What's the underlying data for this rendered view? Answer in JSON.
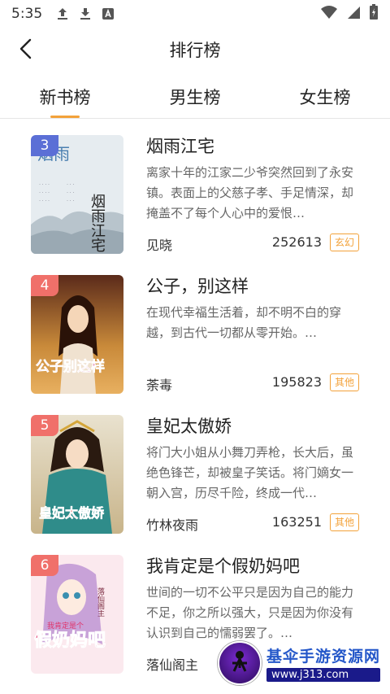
{
  "status_bar": {
    "time": "5:35",
    "left_icons": [
      "upload-icon",
      "download-icon",
      "a-box-icon"
    ],
    "right_icons": [
      "wifi-icon",
      "signal-icon",
      "battery-icon"
    ]
  },
  "header": {
    "title": "排行榜",
    "back_icon": "chevron-left-icon"
  },
  "tabs": [
    {
      "label": "新书榜",
      "active": true
    },
    {
      "label": "男生榜",
      "active": false
    },
    {
      "label": "女生榜",
      "active": false
    }
  ],
  "colors": {
    "accent": "#f3a23a",
    "rank_3": "#5b6fd6",
    "rank_4": "#f0706a",
    "rank_5": "#f0706a",
    "rank_6": "#f0706a"
  },
  "books": [
    {
      "rank": "3",
      "title": "烟雨江宅",
      "description": "离家十年的江家二少爷突然回到了永安镇。表面上的父慈子孝、手足情深，却掩盖不了每个人心中的爱恨…",
      "author": "见晓",
      "count": "252613",
      "tag": "玄幻"
    },
    {
      "rank": "4",
      "title": "公子，别这样",
      "description": "在现代幸福生活着，却不明不白的穿越，到古代一切都从零开始。…",
      "author": "荼毒",
      "count": "195823",
      "tag": "其他"
    },
    {
      "rank": "5",
      "title": "皇妃太傲娇",
      "description": "将门大小姐从小舞刀弄枪，长大后，虽绝色锋芒，却被皇子笑话。将门嫡女一朝入宫，历尽千险，终成一代…",
      "author": "竹林夜雨",
      "count": "163251",
      "tag": "其他"
    },
    {
      "rank": "6",
      "title": "我肯定是个假奶妈吧",
      "description": "世间的一切不公平只是因为自己的能力不足，你之所以强大，只是因为你没有认识到自己的懦弱罢了。…",
      "author": "落仙阁主",
      "count": "",
      "tag": ""
    }
  ],
  "watermark": {
    "name": "基伞手游资源网",
    "url": "www.j313.com"
  }
}
